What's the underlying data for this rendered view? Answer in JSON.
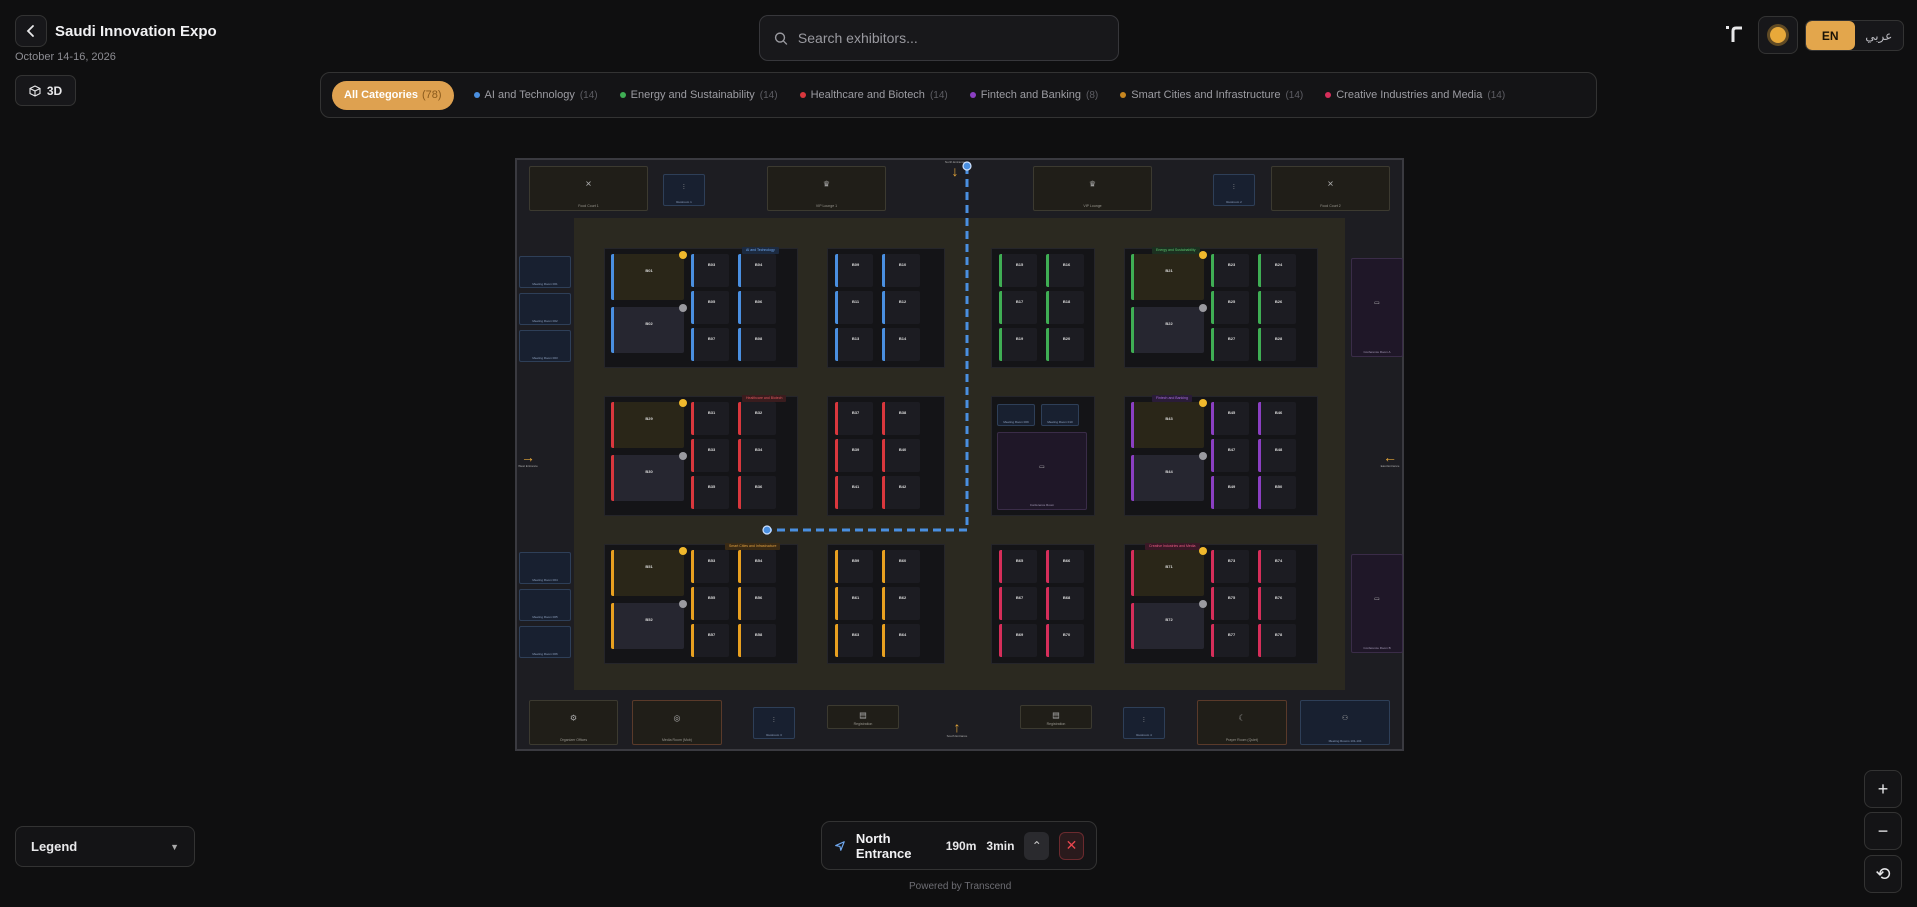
{
  "header": {
    "title": "Saudi Innovation Expo",
    "date": "October 14-16, 2026",
    "view_3d_label": "3D"
  },
  "search": {
    "placeholder": "Search exhibitors..."
  },
  "language": {
    "active": "EN",
    "inactive": "عربي"
  },
  "categories": {
    "all": {
      "label": "All Categories",
      "count": "(78)"
    },
    "items": [
      {
        "label": "AI and Technology",
        "count": "(14)",
        "color": "#4a8fe0"
      },
      {
        "label": "Energy and Sustainability",
        "count": "(14)",
        "color": "#3fae54"
      },
      {
        "label": "Healthcare and Biotech",
        "count": "(14)",
        "color": "#d9373d"
      },
      {
        "label": "Fintech and Banking",
        "count": "(8)",
        "color": "#8b3fc2"
      },
      {
        "label": "Smart Cities and Infrastructure",
        "count": "(14)",
        "color": "#c7861f"
      },
      {
        "label": "Creative Industries and Media",
        "count": "(14)",
        "color": "#d62e5a"
      }
    ]
  },
  "map": {
    "top_facilities": [
      "Food Court 1",
      "Restroom 1",
      "VIP Lounge 1",
      "VIP Lounge",
      "Restroom 2",
      "Food Court 2"
    ],
    "bottom_facilities": [
      "Organizer Offices",
      "Media Room (Mob)",
      "Restroom 3",
      "Registration",
      "Registration",
      "Restroom 4",
      "Prayer Room (Quiet)",
      "Meeting Rooms 101-104"
    ],
    "left_rooms": [
      "Meeting Room 001",
      "Meeting Room 002",
      "Meeting Room 003",
      "Meeting Room 004",
      "Meeting Room 005",
      "Meeting Room 006"
    ],
    "right_rooms": [
      "Conference Room A",
      "Conference Room B"
    ],
    "center_rooms": [
      "Meeting Room 009",
      "Meeting Room 010",
      "Conference Room"
    ],
    "entrances": {
      "north": "North Entrance",
      "south": "South Entrance",
      "west": "West Entrance",
      "east": "East Entrance"
    },
    "zone_tags": [
      "AI and Technology",
      "Healthcare and Biotech",
      "Smart Cities and Infrastructure",
      "Energy and Sustainability",
      "Fintech and Banking",
      "Creative Industries and Media"
    ]
  },
  "booths": {
    "ai": [
      "B01",
      "B02",
      "B03",
      "B04",
      "B05",
      "B06",
      "B07",
      "B08",
      "B09",
      "B10",
      "B11",
      "B12",
      "B13",
      "B14"
    ],
    "energy": [
      "B15",
      "B16",
      "B17",
      "B18",
      "B19",
      "B20",
      "B21",
      "B22",
      "B23",
      "B24",
      "B25",
      "B26",
      "B27",
      "B28"
    ],
    "health": [
      "B29",
      "B30",
      "B31",
      "B32",
      "B33",
      "B34",
      "B35",
      "B36",
      "B37",
      "B38",
      "B39",
      "B40",
      "B41",
      "B42"
    ],
    "fintech": [
      "B43",
      "B44",
      "B45",
      "B46",
      "B47",
      "B48",
      "B49",
      "B50"
    ],
    "smart": [
      "B51",
      "B52",
      "B53",
      "B54",
      "B55",
      "B56",
      "B57",
      "B58",
      "B59",
      "B60",
      "B61",
      "B62",
      "B63",
      "B64"
    ],
    "creative": [
      "B65",
      "B66",
      "B67",
      "B68",
      "B69",
      "B70",
      "B71",
      "B72",
      "B73",
      "B74",
      "B75",
      "B76",
      "B77",
      "B78"
    ]
  },
  "legend": {
    "label": "Legend"
  },
  "navigation": {
    "destination": "North Entrance",
    "distance": "190m",
    "time": "3min"
  },
  "footer": {
    "powered_by": "Powered by Transcend"
  },
  "zoom": {
    "in": "+",
    "out": "−",
    "reset": "⟲"
  }
}
